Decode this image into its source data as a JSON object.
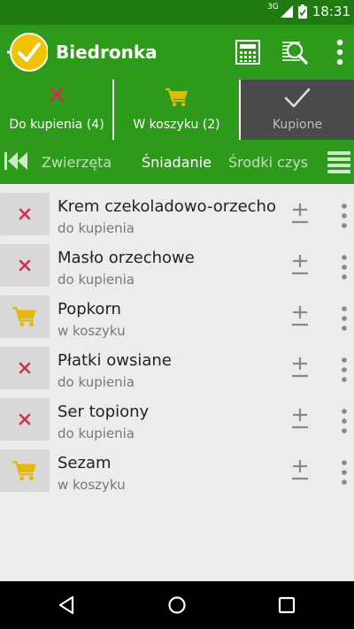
{
  "status_bar": {
    "network": "3G",
    "time": "18:31"
  },
  "app_bar": {
    "title": "Biedronka",
    "icons": [
      "check-logo-icon",
      "calculator-icon",
      "search-list-icon",
      "overflow-menu-icon"
    ]
  },
  "tabs": [
    {
      "label": "Do kupienia (4)",
      "icon": "cross-icon"
    },
    {
      "label": "W koszyku (2)",
      "icon": "cart-icon"
    },
    {
      "label": "Kupione",
      "icon": "check-icon",
      "selected": true
    }
  ],
  "categories": {
    "items": [
      "Zwierzęta",
      "Śniadanie",
      "Środki czys"
    ],
    "selected": "Śniadanie"
  },
  "items": [
    {
      "name": "Krem czekoladowo-orzecho",
      "status": "do kupienia",
      "icon": "cross-icon"
    },
    {
      "name": "Masło orzechowe",
      "status": "do kupienia",
      "icon": "cross-icon"
    },
    {
      "name": "Popkorn",
      "status": "w koszyku",
      "icon": "cart-icon"
    },
    {
      "name": "Płatki owsiane",
      "status": "do kupienia",
      "icon": "cross-icon"
    },
    {
      "name": "Ser topiony",
      "status": "do kupienia",
      "icon": "cross-icon"
    },
    {
      "name": "Sezam",
      "status": "w koszyku",
      "icon": "cart-icon"
    }
  ],
  "colors": {
    "app_green": "#2e9a1b",
    "status_green": "#1f7a10",
    "logo_yellow": "#f2c200",
    "cross_red": "#d32f4a",
    "cart_yellow": "#e6b800",
    "selected_tab": "#4a4a4a"
  }
}
